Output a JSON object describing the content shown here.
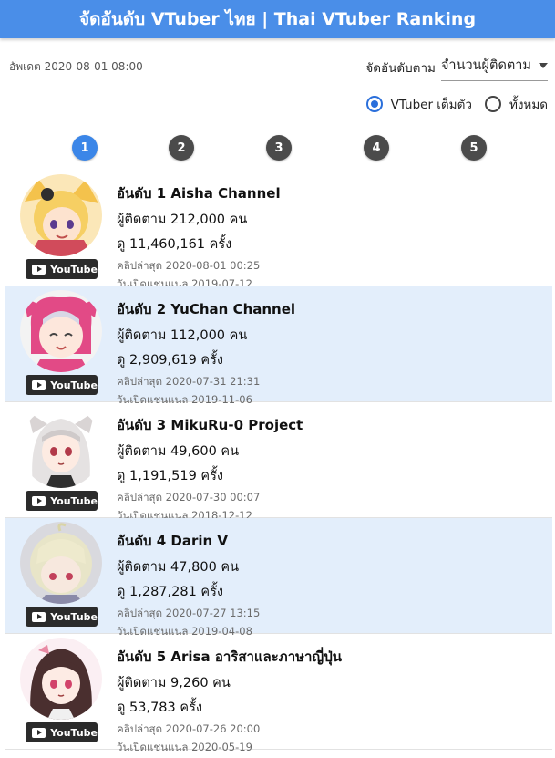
{
  "header": {
    "title": "จัดอันดับ VTuber ไทย | Thai VTuber Ranking"
  },
  "updated": "อัพเดต 2020-08-01 08:00",
  "sort": {
    "label": "จัดอันดับตาม",
    "selected": "จำนวนผู้ติดตาม"
  },
  "filters": [
    {
      "label": "VTuber เต็มตัว",
      "checked": true
    },
    {
      "label": "ทั้งหมด",
      "checked": false
    }
  ],
  "pagination": {
    "pages": [
      "1",
      "2",
      "3",
      "4",
      "5"
    ],
    "active": "1"
  },
  "entries": [
    {
      "title": "อันดับ 1 Aisha Channel",
      "subscribers": "ผู้ติดตาม 212,000 คน",
      "views": "ดู 11,460,161 ครั้ง",
      "last_clip": "คลิปล่าสุด 2020-08-01 00:25",
      "channel_opened": "วันเปิดแชนแนล 2019-07-12",
      "badge": "YouTube"
    },
    {
      "title": "อันดับ 2 YuChan Channel",
      "subscribers": "ผู้ติดตาม 112,000 คน",
      "views": "ดู 2,909,619 ครั้ง",
      "last_clip": "คลิปล่าสุด 2020-07-31 21:31",
      "channel_opened": "วันเปิดแชนแนล 2019-11-06",
      "badge": "YouTube"
    },
    {
      "title": "อันดับ 3 MikuRu-0 Project",
      "subscribers": "ผู้ติดตาม 49,600 คน",
      "views": "ดู 1,191,519 ครั้ง",
      "last_clip": "คลิปล่าสุด 2020-07-30 00:07",
      "channel_opened": "วันเปิดแชนแนล 2018-12-12",
      "badge": "YouTube"
    },
    {
      "title": "อันดับ 4 Darin V",
      "subscribers": "ผู้ติดตาม 47,800 คน",
      "views": "ดู 1,287,281 ครั้ง",
      "last_clip": "คลิปล่าสุด 2020-07-27 13:15",
      "channel_opened": "วันเปิดแชนแนล 2019-04-08",
      "badge": "YouTube"
    },
    {
      "title": "อันดับ 5 Arisa อาริสาและภาษาญี่ปุ่น",
      "subscribers": "ผู้ติดตาม 9,260 คน",
      "views": "ดู 53,783 ครั้ง",
      "last_clip": "คลิปล่าสุด 2020-07-26 20:00",
      "channel_opened": "วันเปิดแชนแนล 2020-05-19",
      "badge": "YouTube"
    }
  ],
  "colors": {
    "appbar": "#4a8ee8",
    "active_page": "#3b86e8",
    "page_button": "#4b4b4b",
    "alt_row": "#e3eefb",
    "radio_selected": "#2a6fdb"
  },
  "icons": {
    "sort_dropdown": "caret-down-icon",
    "badge": "youtube-play-icon"
  }
}
